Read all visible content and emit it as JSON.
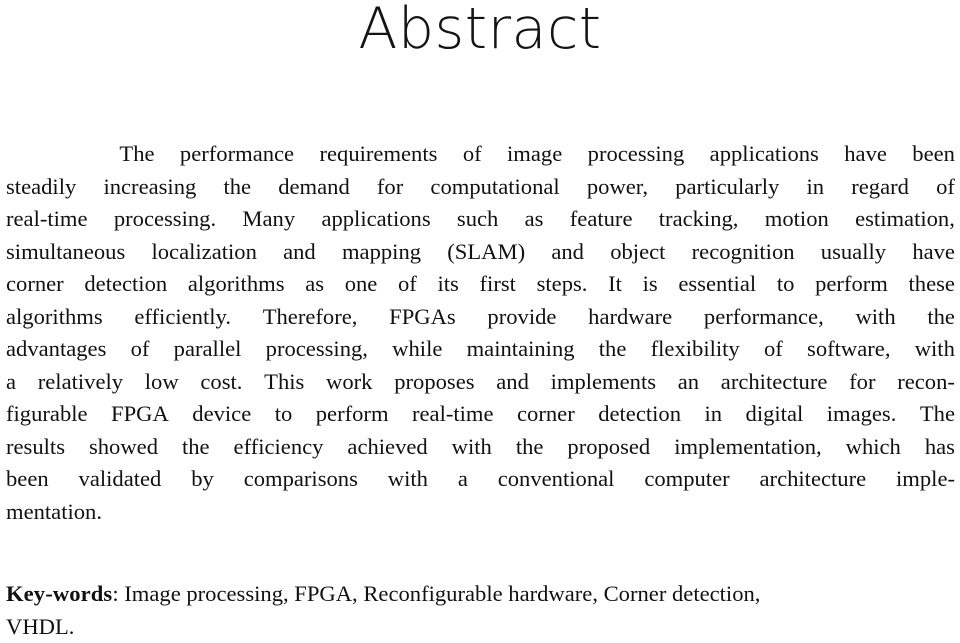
{
  "document": {
    "section_title": "Abstract",
    "background_color": "#ffffff",
    "text_color": "#111111",
    "abstract_paragraph": "The performance requirements of image processing applications have been steadily increasing the demand for computational power, particularly in regard of real-time processing. Many applications such as feature tracking, motion estimation, simultaneous localization and mapping (SLAM) and object recognition usually have corner detection algorithms as one of its first steps. It is essential to perform these algorithms efficiently. Therefore, FPGAs provide hardware performance, with the advantages of parallel processing, while maintaining the flexibility of software, with a relatively low cost. This work proposes and implements an architecture for reconfigurable FPGA device to perform real-time corner detection in digital images. The results showed the efficiency achieved with the proposed implementation, which has been validated by comparisons with a conventional computer architecture implementation.",
    "abstract_lines": [
      "The performance requirements of image processing applications have been",
      "steadily increasing the demand for computational power, particularly in regard of",
      "real-time processing. Many applications such as feature tracking, motion estimation,",
      "simultaneous localization and mapping (SLAM) and object recognition usually have",
      "corner detection algorithms as one of its first steps. It is essential to perform these",
      "algorithms efficiently. Therefore, FPGAs provide hardware performance, with the",
      "advantages of parallel processing, while maintaining the flexibility of software, with",
      "a relatively low cost. This work proposes and implements an architecture for recon-",
      "figurable FPGA device to perform real-time corner detection in digital images. The",
      "results showed the efficiency achieved with the proposed implementation, which has",
      "been validated by comparisons with a conventional computer architecture imple-",
      "mentation."
    ],
    "keywords": {
      "label": "Key-words",
      "separator": ": ",
      "line1": "Image processing, FPGA, Reconfigurable hardware, Corner detection,",
      "line2": "VHDL.",
      "items": [
        "Image processing",
        "FPGA",
        "Reconfigurable hardware",
        "Corner detection",
        "VHDL"
      ]
    }
  }
}
